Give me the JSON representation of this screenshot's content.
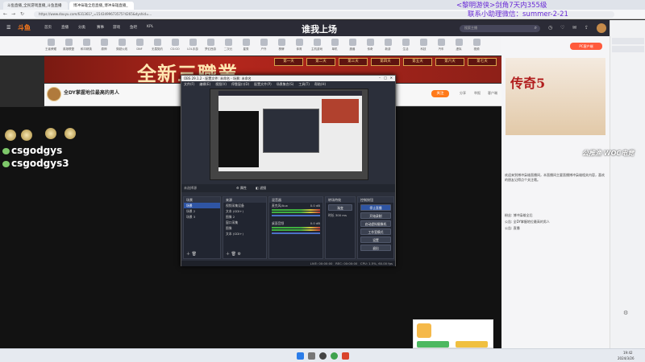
{
  "browser": {
    "tabs": [
      {
        "label": "斗鱼直播_全民游戏直播_斗鱼直播"
      },
      {
        "label": "博冲枭雄全后直播_博冲枭雄直播_"
      }
    ],
    "url": "https://www.douyu.com/631361?_=1543499673575?4265&dyshid=..."
  },
  "site_nav": {
    "logo": "斗鱼",
    "items": [
      "首页",
      "直播",
      "分类",
      "赛事",
      "游戏",
      "鱼吧",
      "KPL"
    ],
    "center_logo": "谁我上场",
    "search_placeholder": "搜索主播",
    "pc_client": "PC客户端"
  },
  "categories": [
    "王者荣耀",
    "英雄联盟",
    "和平精英",
    "原神",
    "穿越火线",
    "DNF",
    "无畏契约",
    "CS:GO",
    "LOL手游",
    "梦幻西游",
    "二次元",
    "星秀",
    "户外",
    "棋牌",
    "体育",
    "主机游戏",
    "单机",
    "魔兽",
    "传奇",
    "新游",
    "生活",
    "科技",
    "汽车",
    "虚拟",
    "视频"
  ],
  "banner": {
    "title": "全新三職業",
    "days": [
      "第一天",
      "第二天",
      "第三天",
      "第四天",
      "第五天",
      "第六天",
      "第七天"
    ]
  },
  "streamer": {
    "room_title": "全DY掌握地位最高的男人",
    "follow_label": "关注",
    "actions": [
      "分享",
      "举报",
      "客户端"
    ]
  },
  "stream": {
    "usernames": [
      "csgodgys",
      "csgodgys3"
    ]
  },
  "overlay": {
    "line1": "<黎明游侠>剑角7天内355级",
    "line2": "联系小助理微信：summer-2-21",
    "woc": "公推渔 WOC电竞"
  },
  "obs": {
    "title": "OBS 29.1.2 - 配置文件: 未命名 - 场景: 未命名",
    "menu": [
      "文件(F)",
      "编辑(E)",
      "视图(V)",
      "停靠窗口(D)",
      "配置文件(P)",
      "场景集合(S)",
      "工具(T)",
      "帮助(H)"
    ],
    "no_source": "未选择源",
    "props_label": "属性",
    "filters_label": "滤镜",
    "scenes": {
      "title": "场景",
      "items": [
        "场景",
        "场景 2",
        "场景 3"
      ]
    },
    "sources": {
      "title": "来源",
      "items": [
        "视频采集设备",
        "文本 (GDI+)",
        "图像 2",
        "窗口采集",
        "图像",
        "文本 (GDI+)"
      ]
    },
    "mixer": {
      "title": "混音器",
      "channels": [
        {
          "name": "麦克风/Aux",
          "level": "0.0 dB"
        },
        {
          "name": "桌面音频",
          "level": "0.0 dB"
        }
      ]
    },
    "transitions": {
      "title": "转场特效",
      "type": "渐变",
      "duration_label": "时长",
      "duration": "300 ms"
    },
    "controls": {
      "title": "控制按钮",
      "buttons": [
        "停止直播",
        "开始录制",
        "启动虚拟摄像机",
        "工作室模式",
        "设置",
        "退出"
      ]
    },
    "status": {
      "live": "LIVE: 00:00:00",
      "rec": "REC: 00:00:00",
      "cpu": "CPU: 1.5%, 60.00 fps"
    }
  },
  "right_panel": {
    "ad_title": "传奇5",
    "desc": "欢迎来到博冲枭雄直播间，本直播间主要直播博冲枭雄相关内容，喜欢的朋友记得点个关注哦。",
    "fans": "粉丝: 博冲枭雄全后",
    "notice": "公告: 全DY掌握地位最高的男人",
    "extra": "公告: 直播"
  },
  "taskbar": {
    "time": "19:42",
    "date": "2024/3/26"
  }
}
